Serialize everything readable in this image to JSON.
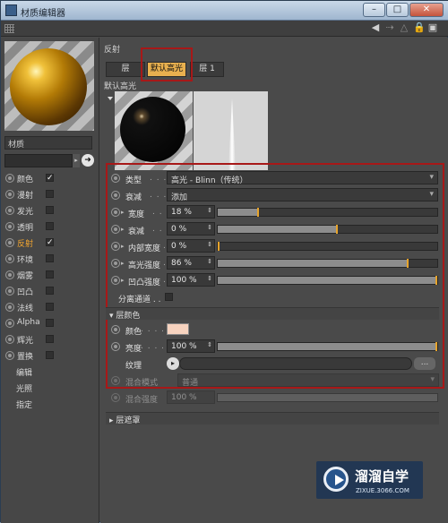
{
  "title": "材质编辑器",
  "window_controls": {
    "minimize": "–",
    "maximize": "□",
    "close": "✕"
  },
  "material": {
    "name": "材质"
  },
  "channels": [
    {
      "name": "颜色",
      "checked": true,
      "active": false
    },
    {
      "name": "漫射",
      "checked": false,
      "active": false
    },
    {
      "name": "发光",
      "checked": false,
      "active": false
    },
    {
      "name": "透明",
      "checked": false,
      "active": false
    },
    {
      "name": "反射",
      "checked": true,
      "active": true
    },
    {
      "name": "环境",
      "checked": false,
      "active": false
    },
    {
      "name": "烟雾",
      "checked": false,
      "active": false
    },
    {
      "name": "凹凸",
      "checked": false,
      "active": false
    },
    {
      "name": "法线",
      "checked": false,
      "active": false
    },
    {
      "name": "Alpha",
      "checked": false,
      "active": false
    },
    {
      "name": "辉光",
      "checked": false,
      "active": false
    },
    {
      "name": "置换",
      "checked": false,
      "active": false
    }
  ],
  "extra_items": [
    "编辑",
    "光照",
    "指定"
  ],
  "reflection": {
    "section_title": "反射",
    "tabs": [
      "层",
      "默认高光",
      "层 1"
    ],
    "layer_title": "默认高光",
    "type": {
      "label": "类型",
      "dots": ". . . . .",
      "value": "高光 - Blinn（传统）"
    },
    "attenuation": {
      "label": "衰减",
      "dots": ". . . . .",
      "value": "添加"
    },
    "params": [
      {
        "label": "宽度",
        "dots": ". . . . .",
        "value": "18 %",
        "fraction": 0.18
      },
      {
        "label": "衰减",
        "dots": ". . . . .",
        "value": "0 %",
        "fraction": 0.54
      },
      {
        "label": "内部宽度",
        "dots": ". . .",
        "value": "0 %",
        "fraction": 0.0
      },
      {
        "label": "高光强度",
        "dots": ". . .",
        "value": "86 %",
        "fraction": 0.86
      },
      {
        "label": "凹凸强度",
        "dots": ". . .",
        "value": "100 %",
        "fraction": 1.0
      }
    ],
    "separate_pass": "分离通道 . .",
    "layer_color": {
      "header": "层颜色",
      "color_label": "颜色",
      "color_dots": ". . . .",
      "color_value": "#f7d3bf",
      "brightness_label": "亮度",
      "brightness_dots": ". . . .",
      "brightness_value": "100 %",
      "brightness_fraction": 1.0,
      "texture_label": "纹理",
      "texture_more": "..."
    },
    "blend_mode": {
      "label": "混合模式",
      "value": "普通"
    },
    "blend_strength": {
      "label": "混合强度",
      "value": "100 %"
    },
    "layer_mask": "层遮罩"
  },
  "watermark": {
    "title": "溜溜自学",
    "sub": "ZIXUE.3066.COM"
  }
}
